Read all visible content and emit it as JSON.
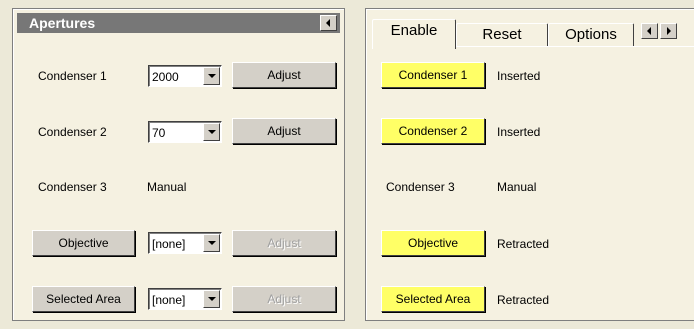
{
  "apertures": {
    "title": "Apertures",
    "rows": [
      {
        "label": "Condenser 1",
        "select": "2000",
        "adjust": "Adjust"
      },
      {
        "label": "Condenser 2",
        "select": "70",
        "adjust": "Adjust"
      },
      {
        "label": "Condenser 3",
        "value": "Manual"
      },
      {
        "button": "Objective",
        "select": "[none]",
        "adjust": "Adjust"
      },
      {
        "button": "Selected Area",
        "select": "[none]",
        "adjust": "Adjust"
      }
    ]
  },
  "status": {
    "tabs": [
      "Enable",
      "Reset",
      "Options"
    ],
    "rows": [
      {
        "label": "Condenser 1",
        "state": "Inserted"
      },
      {
        "label": "Condenser 2",
        "state": "Inserted"
      },
      {
        "label": "Condenser 3",
        "state": "Manual"
      },
      {
        "label": "Objective",
        "state": "Retracted"
      },
      {
        "label": "Selected Area",
        "state": "Retracted"
      }
    ]
  },
  "colors": {
    "title_bar": "#777777",
    "panel_bg": "#f5f1e1",
    "highlight_button": "#ffff66"
  },
  "icons": [
    "arrow-left-icon",
    "arrow-right-icon",
    "dropdown-arrow-icon"
  ]
}
